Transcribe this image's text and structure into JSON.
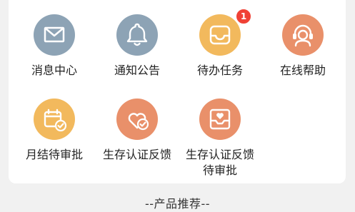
{
  "colors": {
    "slate": "#8da3b5",
    "amber": "#f2b95d",
    "coral": "#e9906a",
    "badge": "#f04135"
  },
  "menu": [
    {
      "label": "消息中心",
      "icon": "envelope-icon"
    },
    {
      "label": "通知公告",
      "icon": "bell-icon"
    },
    {
      "label": "待办任务",
      "icon": "inbox-tray-icon",
      "badge": "1"
    },
    {
      "label": "在线帮助",
      "icon": "headset-agent-icon"
    },
    {
      "label": "月结待审批",
      "icon": "calendar-check-icon"
    },
    {
      "label": "生存认证反馈",
      "icon": "heart-check-icon"
    },
    {
      "label_lines": [
        "生存认证反馈",
        "待审批"
      ],
      "icon": "heart-box-icon"
    }
  ],
  "section_title": "--产品推荐--"
}
